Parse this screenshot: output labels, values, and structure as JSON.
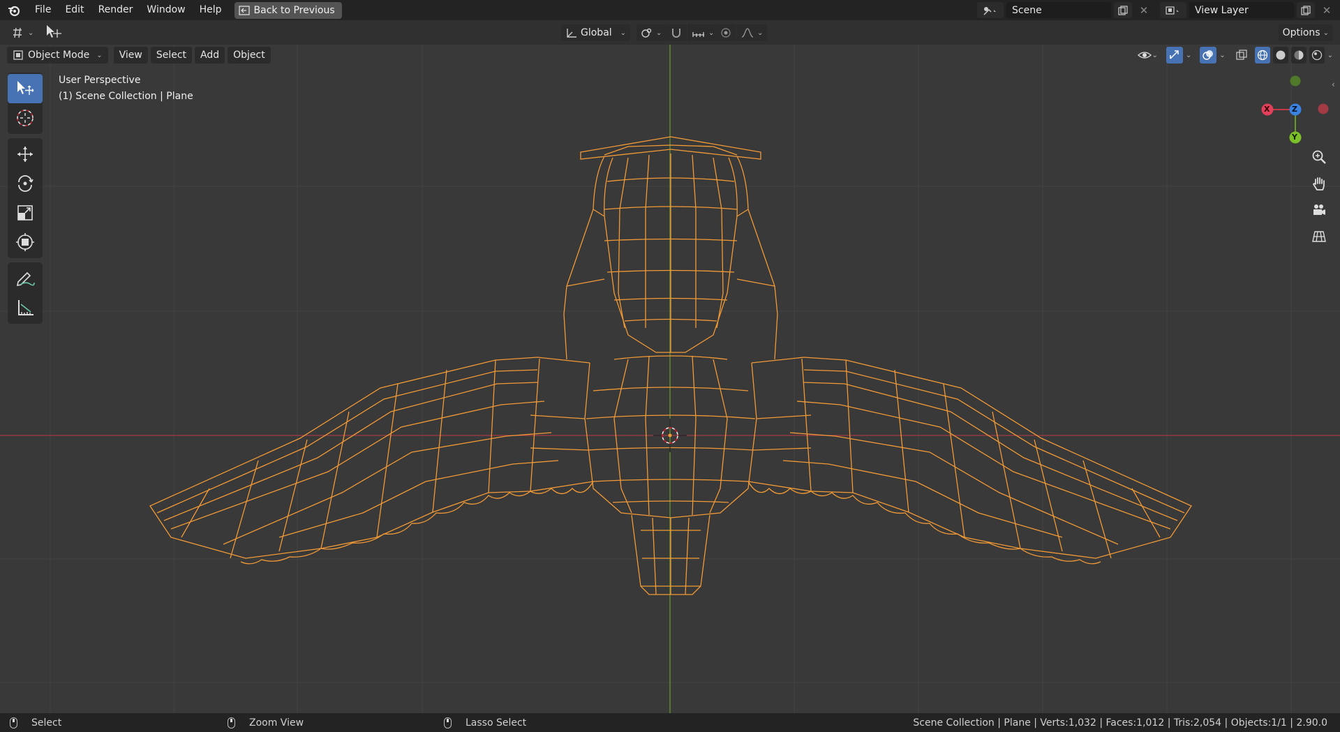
{
  "menubar": {
    "items": [
      "File",
      "Edit",
      "Render",
      "Window",
      "Help"
    ],
    "back_button": "Back to Previous",
    "scene_field": "Scene",
    "view_layer_field": "View Layer"
  },
  "tool_header": {
    "orientation": "Global",
    "options_label": "Options"
  },
  "viewport_header": {
    "mode": "Object Mode",
    "menus": [
      "View",
      "Select",
      "Add",
      "Object"
    ]
  },
  "overlay": {
    "view_name": "User Perspective",
    "collection_info": "(1) Scene Collection | Plane"
  },
  "gizmo": {
    "x_label": "X",
    "y_label": "Y",
    "z_label": "Z"
  },
  "statusbar": {
    "left_action": "Select",
    "middle_action": "Zoom View",
    "right_action": "Lasso Select",
    "stats": "Scene Collection | Plane | Verts:1,032 | Faces:1,012 | Tris:2,054 | Objects:1/1 | 2.90.0"
  },
  "colors": {
    "wire": "#f29a36",
    "x_axis": "#c53944",
    "y_axis": "#6a9a2a",
    "z_axis": "#3b82e0",
    "active_tool": "#4772b3",
    "viewport_bg": "#393939"
  },
  "tools": [
    "select-box",
    "cursor",
    "move",
    "rotate",
    "scale",
    "transform",
    "annotate",
    "measure"
  ]
}
